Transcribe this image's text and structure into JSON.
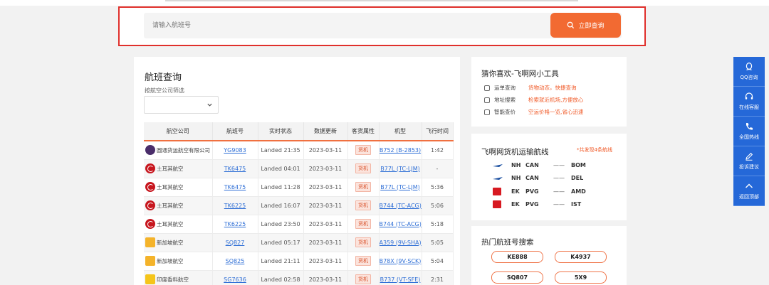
{
  "search": {
    "placeholder": "请输入航班号",
    "button_label": "立即查询",
    "button_color": "#f26a32",
    "highlight_color": "#e0302c"
  },
  "main": {
    "title": "航班查询",
    "filter_label": "按航空公司筛选",
    "filter_value": "",
    "columns": [
      "航空公司",
      "航班号",
      "实时状态",
      "数据更新",
      "客货属性",
      "机型",
      "飞行时间"
    ],
    "rows": [
      {
        "logo": "yg-logo-icon",
        "airline": "圆通货运航空有限公司",
        "flight": "YG9083",
        "status": "Landed 21:35",
        "updated": "2023-03-11",
        "type": "货机",
        "aircraft": "B752 (B-2853)",
        "duration": "1:42"
      },
      {
        "logo": "turkish-airlines-logo-icon",
        "airline": "土耳其航空",
        "flight": "TK6475",
        "status": "Landed 04:01",
        "updated": "2023-03-11",
        "type": "货机",
        "aircraft": "B77L (TC-LJM)",
        "duration": "-"
      },
      {
        "logo": "turkish-airlines-logo-icon",
        "airline": "土耳其航空",
        "flight": "TK6475",
        "status": "Landed 11:28",
        "updated": "2023-03-11",
        "type": "货机",
        "aircraft": "B77L (TC-LJM)",
        "duration": "5:36"
      },
      {
        "logo": "turkish-airlines-logo-icon",
        "airline": "土耳其航空",
        "flight": "TK6225",
        "status": "Landed 16:07",
        "updated": "2023-03-11",
        "type": "货机",
        "aircraft": "B744 (TC-ACG)",
        "duration": "5:06"
      },
      {
        "logo": "turkish-airlines-logo-icon",
        "airline": "土耳其航空",
        "flight": "TK6225",
        "status": "Landed 23:50",
        "updated": "2023-03-11",
        "type": "货机",
        "aircraft": "B744 (TC-ACG)",
        "duration": "5:18"
      },
      {
        "logo": "singapore-airlines-logo-icon",
        "airline": "新加坡航空",
        "flight": "SQ827",
        "status": "Landed 05:17",
        "updated": "2023-03-11",
        "type": "货机",
        "aircraft": "A359 (9V-SHA)",
        "duration": "5:05"
      },
      {
        "logo": "singapore-airlines-logo-icon",
        "airline": "新加坡航空",
        "flight": "SQ825",
        "status": "Landed 21:11",
        "updated": "2023-03-11",
        "type": "货机",
        "aircraft": "B78X (9V-SCK)",
        "duration": "5:04"
      },
      {
        "logo": "spicejet-logo-icon",
        "airline": "印度香料航空",
        "flight": "SG7636",
        "status": "Landed 02:58",
        "updated": "2023-03-11",
        "type": "货机",
        "aircraft": "B737 (VT-SFE)",
        "duration": "2:31"
      }
    ]
  },
  "tools": {
    "title": "猜你喜欢-飞啊网小工具",
    "items": [
      {
        "icon": "document-icon",
        "name": "运单查询",
        "desc": "货物动态，快捷查询"
      },
      {
        "icon": "location-icon",
        "name": "地址搜索",
        "desc": "检索就近机场,方便放心"
      },
      {
        "icon": "price-icon",
        "name": "智能查价",
        "desc": "空运价格一览,省心迅速"
      }
    ]
  },
  "routes": {
    "title": "飞啊网货机运输航线",
    "count_note": "*共发现4条航线",
    "items": [
      {
        "logo": "ana-logo-icon",
        "carrier": "NH",
        "from": "CAN",
        "dash": "——",
        "to": "BOM"
      },
      {
        "logo": "ana-logo-icon",
        "carrier": "NH",
        "from": "CAN",
        "dash": "——",
        "to": "DEL"
      },
      {
        "logo": "emirates-logo-icon",
        "carrier": "EK",
        "from": "PVG",
        "dash": "——",
        "to": "AMD"
      },
      {
        "logo": "emirates-logo-icon",
        "carrier": "EK",
        "from": "PVG",
        "dash": "——",
        "to": "IST"
      }
    ]
  },
  "hot": {
    "title": "热门航班号搜索",
    "items": [
      "KE888",
      "K4937",
      "SQ807",
      "5X9"
    ]
  },
  "float_bar": {
    "color": "#2568d8",
    "items": [
      {
        "icon": "qq-icon",
        "label": "QQ咨询"
      },
      {
        "icon": "headset-icon",
        "label": "在线客服"
      },
      {
        "icon": "phone-icon",
        "label": "全国热线"
      },
      {
        "icon": "pencil-icon",
        "label": "投诉建议"
      },
      {
        "icon": "arrow-up-icon",
        "label": "返回顶部"
      }
    ]
  }
}
